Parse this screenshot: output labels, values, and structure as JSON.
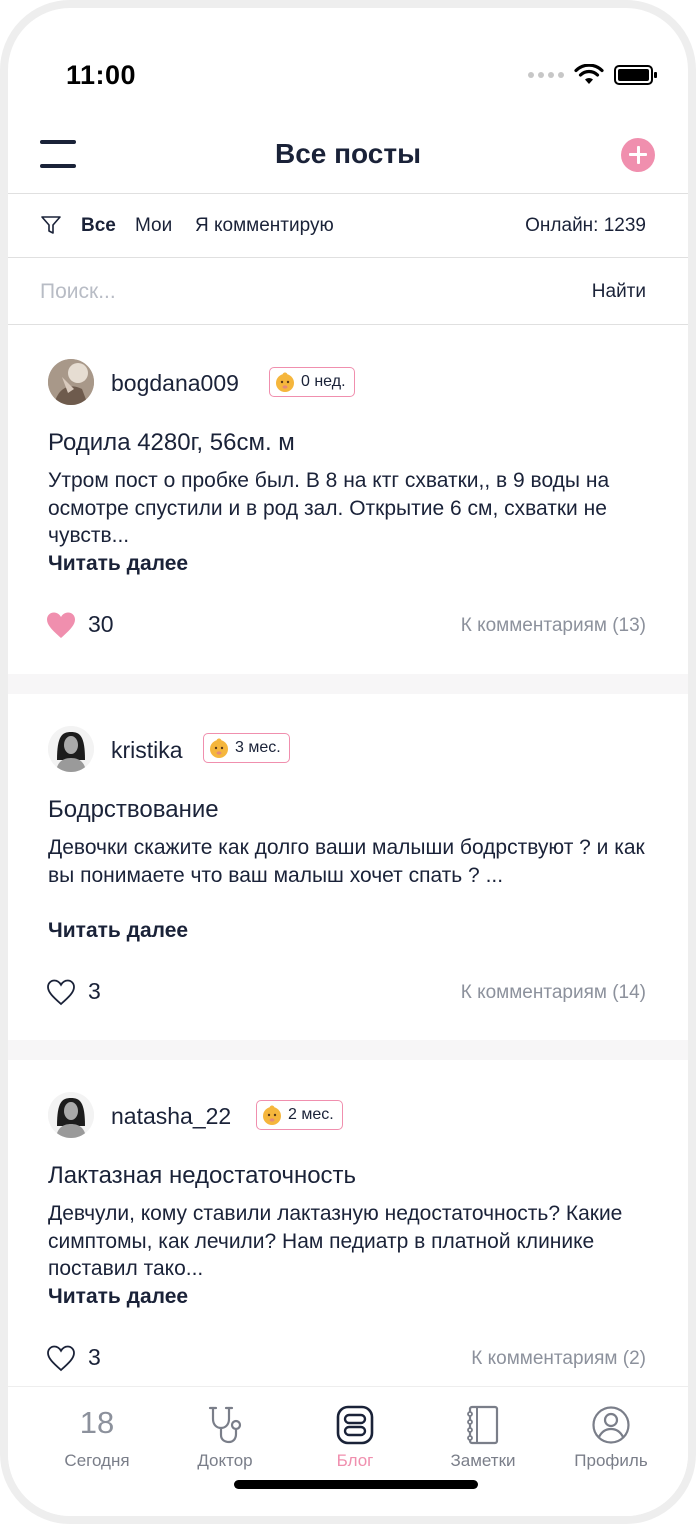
{
  "status_bar": {
    "time": "11:00"
  },
  "header": {
    "title": "Все посты"
  },
  "filters": {
    "tabs": [
      {
        "label": "Все",
        "active": true
      },
      {
        "label": "Мои",
        "active": false
      },
      {
        "label": "Я комментирую",
        "active": false
      }
    ],
    "online_label": "Онлайн: 1239"
  },
  "search": {
    "placeholder": "Поиск...",
    "button_label": "Найти"
  },
  "posts": [
    {
      "username": "bogdana009",
      "badge": "0 нед.",
      "title": "Родила 4280г, 56см. м",
      "text": "Утром пост о пробке был. В 8 на ктг схватки,, в 9 воды на осмотре спустили и в род зал. Открытие 6 см, схватки не чувств...",
      "read_more": "Читать далее",
      "likes": "30",
      "liked": true,
      "comments": "К комментариям (13)"
    },
    {
      "username": "kristika",
      "badge": "3 мес.",
      "title": "Бодрствование",
      "text": "Девочки скажите как долго ваши малыши бодрствуют ? и как вы понимаете что ваш малыш хочет спать ? ...",
      "read_more": "Читать далее",
      "likes": "3",
      "liked": false,
      "comments": "К комментариям (14)"
    },
    {
      "username": "natasha_22",
      "badge": "2 мес.",
      "title": "Лактазная недостаточность",
      "text": "Девчули, кому ставили лактазную недостаточность? Какие симптомы, как лечили? Нам педиатр в платной клинике поставил тако...",
      "read_more": "Читать далее",
      "likes": "3",
      "liked": false,
      "comments": "К комментариям (2)"
    }
  ],
  "tab_bar": {
    "items": [
      {
        "label": "Сегодня",
        "value": "18",
        "icon": "calendar-date-icon"
      },
      {
        "label": "Доктор",
        "icon": "stethoscope-icon"
      },
      {
        "label": "Блог",
        "icon": "blog-icon",
        "active": true
      },
      {
        "label": "Заметки",
        "icon": "notebook-icon"
      },
      {
        "label": "Профиль",
        "icon": "profile-icon"
      }
    ]
  },
  "colors": {
    "accent": "#f08fae",
    "text": "#1a2238",
    "muted": "#8c919c"
  }
}
